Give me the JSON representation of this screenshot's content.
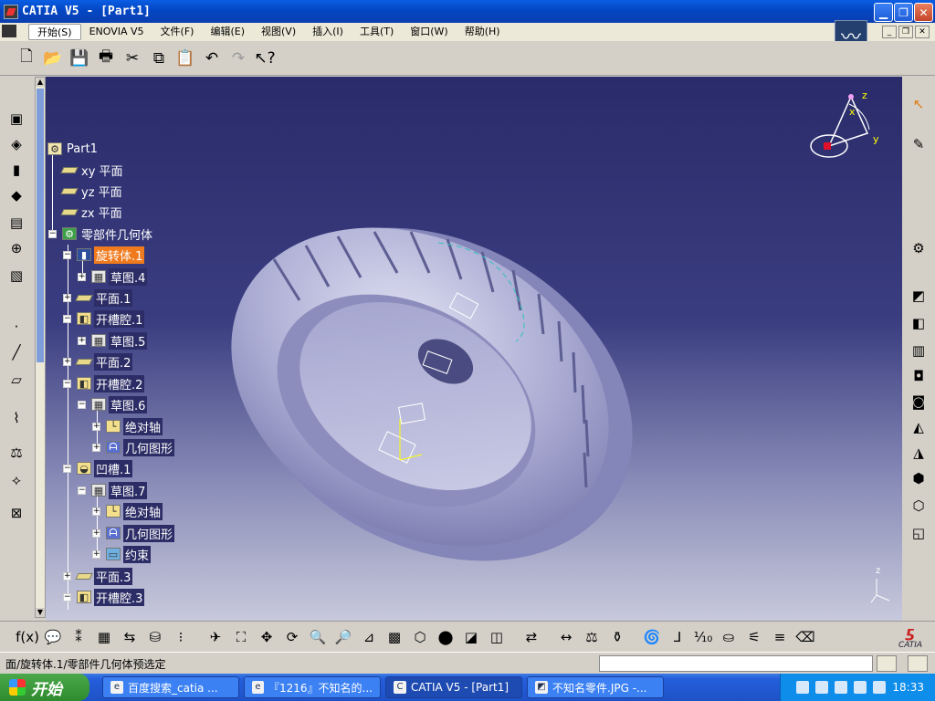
{
  "window": {
    "title": "CATIA V5 - [Part1]"
  },
  "menu": [
    {
      "label": "开始(S)"
    },
    {
      "label": "ENOVIA V5"
    },
    {
      "label": "文件(F)"
    },
    {
      "label": "编辑(E)"
    },
    {
      "label": "视图(V)"
    },
    {
      "label": "插入(I)"
    },
    {
      "label": "工具(T)"
    },
    {
      "label": "窗口(W)"
    },
    {
      "label": "帮助(H)"
    }
  ],
  "toolbar_icons": [
    "new-icon",
    "open-icon",
    "save-icon",
    "print-icon",
    "cut-icon",
    "copy-icon",
    "paste-icon",
    "undo-icon",
    "redo-icon",
    "whats-this-icon"
  ],
  "tree": {
    "root": "Part1",
    "items": [
      {
        "label": "xy 平面"
      },
      {
        "label": "yz 平面"
      },
      {
        "label": "zx 平面"
      },
      {
        "label": "零部件几何体"
      },
      {
        "label": "旋转体.1"
      },
      {
        "label": "草图.4"
      },
      {
        "label": "平面.1"
      },
      {
        "label": "开槽腔.1"
      },
      {
        "label": "草图.5"
      },
      {
        "label": "平面.2"
      },
      {
        "label": "开槽腔.2"
      },
      {
        "label": "草图.6"
      },
      {
        "label": "绝对轴"
      },
      {
        "label": "几何图形"
      },
      {
        "label": "凹槽.1"
      },
      {
        "label": "草图.7"
      },
      {
        "label": "绝对轴"
      },
      {
        "label": "几何图形"
      },
      {
        "label": "约束"
      },
      {
        "label": "平面.3"
      },
      {
        "label": "开槽腔.3"
      }
    ]
  },
  "compass": {
    "x_label": "x",
    "y_label": "y",
    "z_label": "z"
  },
  "mini_axis": {
    "z_label": "z"
  },
  "status_text": "面/旋转体.1/零部件几何体预选定",
  "brand": {
    "catia_logo": "CATIA"
  },
  "taskbar": {
    "start_label": "开始",
    "tasks": [
      {
        "label": "百度搜索_catia ..."
      },
      {
        "label": "『1216』不知名的..."
      },
      {
        "label": "CATIA V5 - [Part1]"
      },
      {
        "label": "不知名零件.JPG -..."
      }
    ],
    "clock": "18:33"
  },
  "colors": {
    "selected": "#f07a1e",
    "viewport_top": "#2a2b6a",
    "viewport_bottom": "#c8c9dc",
    "part": "#a6a7cf"
  }
}
